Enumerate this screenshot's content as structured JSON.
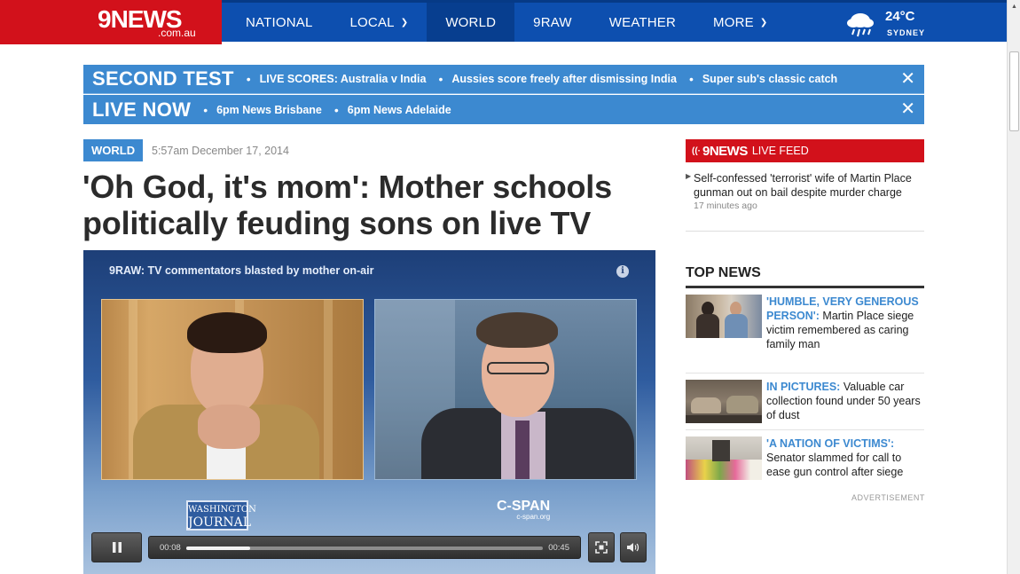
{
  "header": {
    "logo_text": "9NEWS",
    "logo_domain": ".com.au",
    "nav": [
      {
        "label": "NATIONAL",
        "dropdown": false
      },
      {
        "label": "LOCAL",
        "dropdown": true
      },
      {
        "label": "WORLD",
        "dropdown": false,
        "active": true
      },
      {
        "label": "9RAW",
        "dropdown": false
      },
      {
        "label": "WEATHER",
        "dropdown": false
      },
      {
        "label": "MORE",
        "dropdown": true
      }
    ],
    "weather": {
      "temp": "24°C",
      "city": "SYDNEY",
      "icon": "rain-cloud-icon"
    }
  },
  "tickers": [
    {
      "label": "SECOND TEST",
      "items": [
        "LIVE SCORES: Australia v India",
        "Aussies score freely after dismissing India",
        "Super sub's classic catch"
      ]
    },
    {
      "label": "LIVE NOW",
      "items": [
        "6pm News Brisbane",
        "6pm News Adelaide"
      ]
    }
  ],
  "article": {
    "section": "WORLD",
    "timestamp": "5:57am December 17, 2014",
    "headline": "'Oh God, it's mom': Mother schools politically feuding sons on live TV"
  },
  "video": {
    "title": "9RAW: TV commentators blasted by mother on-air",
    "info_icon_label": "i",
    "logo_left_line1": "WASHINGTON",
    "logo_left_line2": "JOURNAL",
    "logo_right": "C-SPAN",
    "logo_right_sub": "c-span.org",
    "current_time": "00:08",
    "duration": "00:45",
    "progress": 0.18
  },
  "livefeed": {
    "brand": "9NEWS",
    "label": "LIVE FEED",
    "item": {
      "text": "Self-confessed 'terrorist' wife of Martin Place gunman out on bail despite murder charge",
      "ago": "17 minutes ago"
    }
  },
  "topnews": {
    "title": "TOP NEWS",
    "items": [
      {
        "kicker": "'HUMBLE, VERY GENEROUS PERSON':",
        "text": "Martin Place siege victim remembered as caring family man"
      },
      {
        "kicker": "IN PICTURES:",
        "text": "Valuable car collection found under 50 years of dust"
      },
      {
        "kicker": "'A NATION OF VICTIMS':",
        "text": "Senator slammed for call to ease gun control after siege"
      }
    ],
    "ad_label": "ADVERTISEMENT"
  },
  "colors": {
    "brand_red": "#d2111b",
    "nav_blue": "#0d4faf",
    "accent_blue": "#3c89d0"
  }
}
